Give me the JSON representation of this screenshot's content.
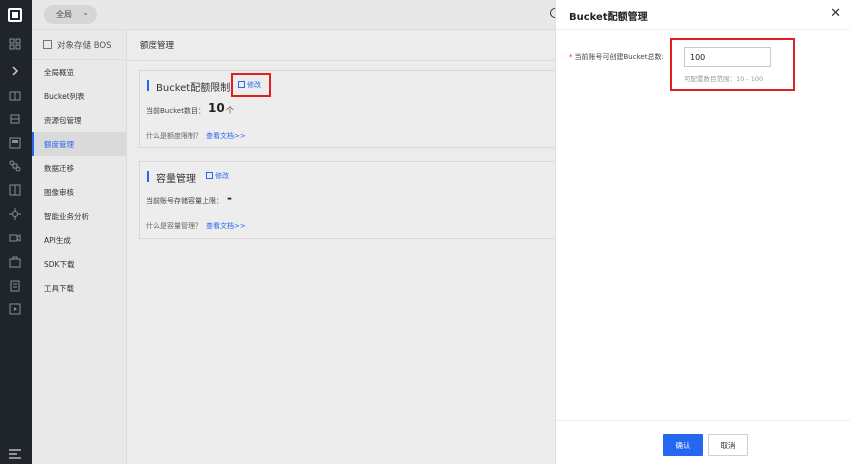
{
  "rail": {
    "icons": [
      "logo-icon",
      "grid-icon",
      "expand-chevron-icon",
      "network-icon",
      "layers-icon",
      "storage-icon",
      "command-icon",
      "apps-icon",
      "settings-icon",
      "video-icon",
      "briefcase-icon",
      "document-icon",
      "play-icon",
      "menu-icon"
    ]
  },
  "topbar": {
    "region": "全局"
  },
  "service": {
    "title": "对象存储 BOS",
    "items": [
      {
        "label": "全局概览"
      },
      {
        "label": "Bucket列表"
      },
      {
        "label": "资源包管理"
      },
      {
        "label": "额度管理"
      },
      {
        "label": "数据迁移"
      },
      {
        "label": "图像审核"
      },
      {
        "label": "智能业务分析"
      },
      {
        "label": "API生成"
      },
      {
        "label": "SDK下载"
      },
      {
        "label": "工具下载"
      }
    ],
    "active_index": 3
  },
  "main": {
    "title": "额度管理",
    "bucket_card": {
      "title": "Bucket配额限制",
      "edit": "修改",
      "count_label": "当前Bucket数目：",
      "count_value": "10",
      "count_unit": "个",
      "help": "什么是额度限制？",
      "doc_link": "查看文档>>"
    },
    "capacity_card": {
      "title": "容量管理",
      "edit": "修改",
      "limit_label": "当前账号存储容量上限：",
      "limit_value": "-",
      "help": "什么是容量管理？",
      "doc_link": "查看文档>>"
    }
  },
  "drawer": {
    "title": "Bucket配额管理",
    "required_mark": "*",
    "field_label": "当前账号可创建Bucket总数:",
    "field_value": "100",
    "hint": "可配置数目范围：10 - 100",
    "ok": "确认",
    "cancel": "取消"
  },
  "colors": {
    "accent": "#2468f2",
    "highlight": "#e02020",
    "rail": "#20242b"
  }
}
